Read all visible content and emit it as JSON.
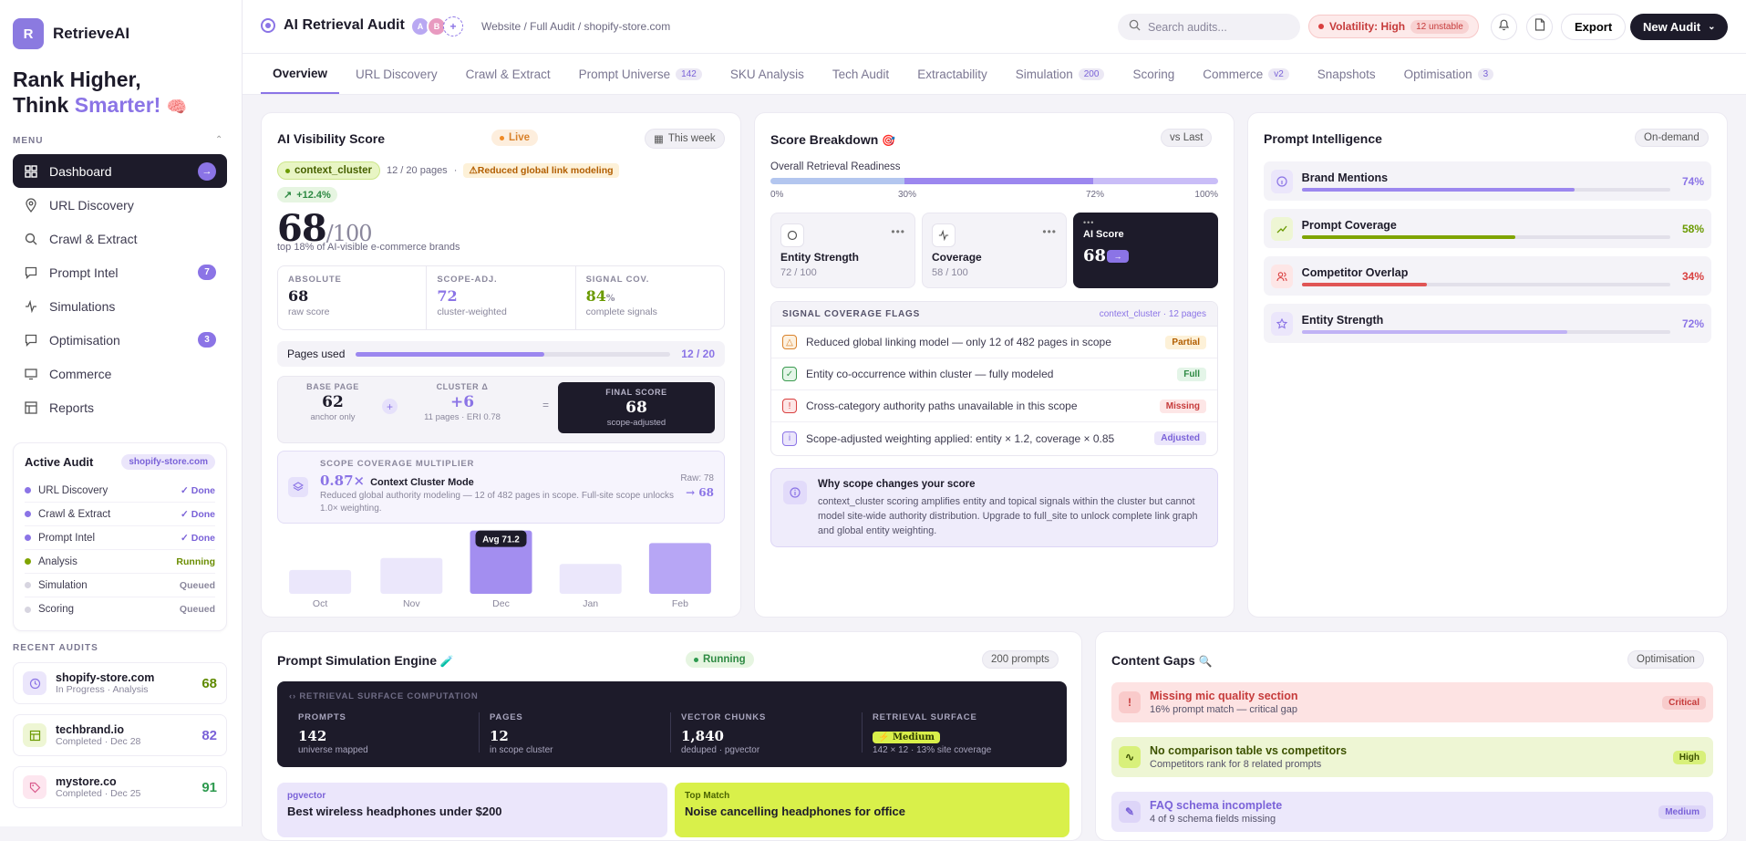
{
  "app": {
    "name": "RetrieveAI",
    "logo_letter": "R"
  },
  "hero": {
    "line1": "Rank Higher,",
    "line2_prefix": "Think ",
    "line2_accent": "Smarter!",
    "emoji": "🧠"
  },
  "sidebar": {
    "menu_label": "MENU",
    "items": [
      {
        "label": "Dashboard",
        "icon": "grid-icon",
        "active": true
      },
      {
        "label": "URL Discovery",
        "icon": "pin-icon"
      },
      {
        "label": "Crawl & Extract",
        "icon": "search-icon"
      },
      {
        "label": "Prompt Intel",
        "icon": "chat-icon",
        "badge": "7"
      },
      {
        "label": "Simulations",
        "icon": "pulse-icon"
      },
      {
        "label": "Optimisation",
        "icon": "chat-icon",
        "badge": "3"
      },
      {
        "label": "Commerce",
        "icon": "monitor-icon"
      },
      {
        "label": "Reports",
        "icon": "table-icon"
      }
    ],
    "active_audit": {
      "title": "Active Audit",
      "domain": "shopify-store.com",
      "steps": [
        {
          "name": "URL Discovery",
          "status": "✓ Done",
          "color": "#8b74e6",
          "status_color": "#7a62d8"
        },
        {
          "name": "Crawl & Extract",
          "status": "✓ Done",
          "color": "#8b74e6",
          "status_color": "#7a62d8"
        },
        {
          "name": "Prompt Intel",
          "status": "✓ Done",
          "color": "#8b74e6",
          "status_color": "#7a62d8"
        },
        {
          "name": "Analysis",
          "status": "Running",
          "color": "#7fa400",
          "status_color": "#6a8c00"
        },
        {
          "name": "Simulation",
          "status": "Queued",
          "color": "#d7d5e0",
          "status_color": "#8a879c"
        },
        {
          "name": "Scoring",
          "status": "Queued",
          "color": "#d7d5e0",
          "status_color": "#8a879c"
        }
      ]
    },
    "recent_label": "RECENT AUDITS",
    "recent": [
      {
        "name": "shopify-store.com",
        "sub": "In Progress · Analysis",
        "score": "68",
        "score_color": "#5f8a00",
        "icon": "clock-icon",
        "bg": "#ebe6fb"
      },
      {
        "name": "techbrand.io",
        "sub": "Completed · Dec 28",
        "score": "82",
        "score_color": "#7a62d8",
        "icon": "layout-icon",
        "bg": "#eef6d4"
      },
      {
        "name": "mystore.co",
        "sub": "Completed · Dec 25",
        "score": "91",
        "score_color": "#2e9a4f",
        "icon": "tag-icon",
        "bg": "#fde6ef"
      }
    ]
  },
  "header": {
    "title": "AI Retrieval Audit",
    "avatars": [
      "A",
      "B",
      "+"
    ],
    "breadcrumb": "Website / Full Audit / shopify-store.com",
    "search_placeholder": "Search audits...",
    "volatility": "Volatility: High",
    "unstable": "12 unstable",
    "export": "Export",
    "new_audit": "New Audit"
  },
  "tabs": [
    {
      "label": "Overview",
      "active": true
    },
    {
      "label": "URL Discovery"
    },
    {
      "label": "Crawl & Extract"
    },
    {
      "label": "Prompt Universe",
      "count": "142"
    },
    {
      "label": "SKU Analysis"
    },
    {
      "label": "Tech Audit"
    },
    {
      "label": "Extractability"
    },
    {
      "label": "Simulation",
      "count": "200"
    },
    {
      "label": "Scoring"
    },
    {
      "label": "Commerce",
      "count": "v2"
    },
    {
      "label": "Snapshots"
    },
    {
      "label": "Optimisation",
      "count": "3"
    }
  ],
  "visibility": {
    "title": "AI Visibility Score",
    "live": "Live",
    "period": "This week",
    "context": "context_cluster",
    "pages": "12 / 20 pages",
    "warning": "Reduced global link modeling",
    "delta": "+12.4%",
    "score": "68",
    "denominator": "/100",
    "caption": "top 18% of AI-visible e-commerce brands",
    "metrics": [
      {
        "label": "ABSOLUTE",
        "value": "68",
        "sub": "raw score",
        "color": "#1d1b2a"
      },
      {
        "label": "SCOPE-ADJ.",
        "value": "72",
        "sub": "cluster-weighted",
        "color": "#8b74e6"
      },
      {
        "label": "SIGNAL COV.",
        "value": "84",
        "unit": "%",
        "sub": "complete signals",
        "color": "#6a9a00"
      }
    ],
    "pages_used_label": "Pages used",
    "pages_used_value": "12 / 20",
    "pages_used_fraction": 0.6,
    "formula": {
      "base_label": "BASE PAGE",
      "base_value": "62",
      "base_sub": "anchor only",
      "op1": "+",
      "cluster_label": "CLUSTER Δ",
      "cluster_value": "+6",
      "cluster_sub": "11 pages · ERI 0.78",
      "op2": "=",
      "final_label": "FINAL SCORE",
      "final_value": "68",
      "final_sub": "scope-adjusted"
    },
    "multiplier": {
      "label": "SCOPE COVERAGE MULTIPLIER",
      "value": "0.87×",
      "mode": "Context Cluster Mode",
      "desc": "Reduced global authority modeling — 12 of 482 pages in scope. Full-site scope unlocks 1.0× weighting.",
      "raw": "Raw: 78",
      "final": "→ 68"
    }
  },
  "chart_data": {
    "type": "bar",
    "categories": [
      "Oct",
      "Nov",
      "Dec",
      "Jan",
      "Feb"
    ],
    "values": [
      58,
      62,
      71.2,
      60,
      67
    ],
    "highlight_index": 2,
    "annotation": "Avg 71.2",
    "ylim": [
      50,
      72
    ]
  },
  "breakdown": {
    "title": "Score Breakdown",
    "emoji": "🎯",
    "compare": "vs Last",
    "readiness_label": "Overall Retrieval Readiness",
    "readiness_ticks": [
      "0%",
      "30%",
      "72%",
      "100%"
    ],
    "cards": [
      {
        "name": "Entity Strength",
        "value": "72 / 100",
        "icon": "circle-icon"
      },
      {
        "name": "Coverage",
        "value": "58 / 100",
        "icon": "pulse-icon"
      },
      {
        "name": "AI Score",
        "value": "68"
      }
    ],
    "flags_title": "SIGNAL COVERAGE FLAGS",
    "flags_scope": "context_cluster · 12 pages",
    "flags": [
      {
        "text": "Reduced global linking model — only 12 of 482 pages in scope",
        "status": "Partial",
        "icon": "warning-icon",
        "glyph": "△",
        "icolor": "#d9822b",
        "ibg": "#fdf1e0",
        "bg": "#fdf1d8",
        "fg": "#b25e00"
      },
      {
        "text": "Entity co-occurrence within cluster — fully modeled",
        "status": "Full",
        "icon": "check-icon",
        "glyph": "✓",
        "icolor": "#3a9a4f",
        "ibg": "#e4f5e8",
        "bg": "#e4f5e8",
        "fg": "#2e8a43"
      },
      {
        "text": "Cross-category authority paths unavailable in this scope",
        "status": "Missing",
        "icon": "alert-icon",
        "glyph": "!",
        "icolor": "#d94040",
        "ibg": "#fde6e6",
        "bg": "#fde6e6",
        "fg": "#c63b3b"
      },
      {
        "text": "Scope-adjusted weighting applied: entity × 1.2, coverage × 0.85",
        "status": "Adjusted",
        "icon": "info-icon",
        "glyph": "i",
        "icolor": "#8b74e6",
        "ibg": "#ebe6fb",
        "bg": "#ebe6fb",
        "fg": "#7a62d8"
      }
    ],
    "why_title": "Why scope changes your score",
    "why_desc": "context_cluster scoring amplifies entity and topical signals within the cluster but cannot model site-wide authority distribution. Upgrade to full_site to unlock complete link graph and global entity weighting."
  },
  "prompt_intel": {
    "title": "Prompt Intelligence",
    "mode": "On-demand",
    "rows": [
      {
        "name": "Brand Mentions",
        "pct": "74%",
        "value": 0.74,
        "color": "#9c87ef",
        "pct_color": "#8b74e6",
        "icon": "info-icon",
        "ibg": "#ebe6fb",
        "icolor": "#8b74e6"
      },
      {
        "name": "Prompt Coverage",
        "pct": "58%",
        "value": 0.58,
        "color": "#7fa400",
        "pct_color": "#6a9a00",
        "icon": "trend-icon",
        "ibg": "#eef6d4",
        "icolor": "#6a9a00"
      },
      {
        "name": "Competitor Overlap",
        "pct": "34%",
        "value": 0.34,
        "color": "#e05555",
        "pct_color": "#d94040",
        "icon": "users-icon",
        "ibg": "#fde6e6",
        "icolor": "#d94040"
      },
      {
        "name": "Entity Strength",
        "pct": "72%",
        "value": 0.72,
        "color": "#c0b2f5",
        "pct_color": "#8b74e6",
        "icon": "star-icon",
        "ibg": "#ebe6fb",
        "icolor": "#8b74e6"
      }
    ]
  },
  "simulation": {
    "title": "Prompt Simulation Engine",
    "emoji": "🧪",
    "status": "Running",
    "count": "200 prompts",
    "panel_label": "RETRIEVAL SURFACE COMPUTATION",
    "stats": [
      {
        "label": "PROMPTS",
        "value": "142",
        "sub": "universe mapped"
      },
      {
        "label": "PAGES",
        "value": "12",
        "sub": "in scope cluster"
      },
      {
        "label": "VECTOR CHUNKS",
        "value": "1,840",
        "sub": "deduped · pgvector"
      },
      {
        "label": "RETRIEVAL SURFACE",
        "value": "Medium",
        "sub": "142 × 12 · 13% site coverage"
      }
    ],
    "queries": [
      {
        "label": "pgvector",
        "text": "Best wireless headphones under $200",
        "bg": "#ebe6fb",
        "lc": "#7a62d8"
      },
      {
        "label": "Top Match",
        "text": "Noise cancelling headphones for office",
        "bg": "#d9f04a",
        "lc": "#4a6300"
      }
    ]
  },
  "gaps": {
    "title": "Content Gaps",
    "emoji": "🔍",
    "mode": "Optimisation",
    "rows": [
      {
        "title": "Missing mic quality section",
        "sub": "16% prompt match — critical gap",
        "badge": "Critical",
        "bg": "#fde3e3",
        "tc": "#c63b3b",
        "bbg": "#f8cccc",
        "icon": "alert-icon",
        "glyph": "!",
        "ibg": "#f9caca"
      },
      {
        "title": "No comparison table vs competitors",
        "sub": "Competitors rank for 8 related prompts",
        "badge": "High",
        "bg": "#eef6d4",
        "tc": "#3d5200",
        "bbg": "#d8f07a",
        "icon": "pulse-icon",
        "glyph": "∿",
        "ibg": "#d8f07a"
      },
      {
        "title": "FAQ schema incomplete",
        "sub": "4 of 9 schema fields missing",
        "badge": "Medium",
        "bg": "#ece8fb",
        "tc": "#7a62d8",
        "bbg": "#ddd5f8",
        "icon": "edit-icon",
        "glyph": "✎",
        "ibg": "#ddd5f8"
      }
    ]
  }
}
